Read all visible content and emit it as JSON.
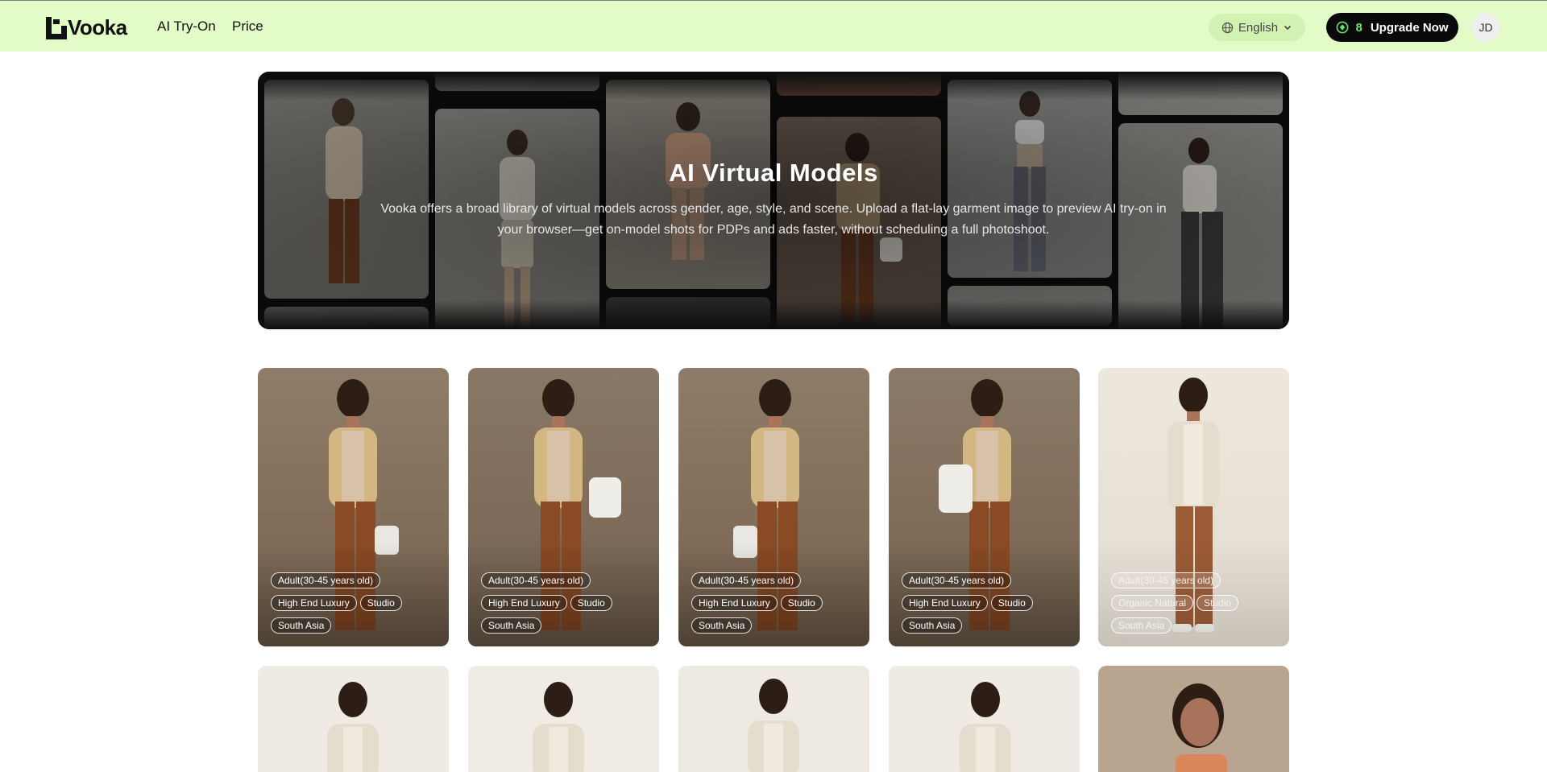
{
  "header": {
    "brand": "Vooka",
    "nav": [
      "AI Try-On",
      "Price"
    ],
    "language": "English",
    "credits": "8",
    "upgrade_label": "Upgrade Now",
    "avatar_initials": "JD"
  },
  "hero": {
    "title": "AI Virtual Models",
    "description": "Vooka offers a broad library of virtual models across gender, age, style, and scene. Upload a flat-lay garment image to preview AI try-on in your browser—get on-model shots for PDPs and ads faster, without scheduling a full photoshoot."
  },
  "gallery": {
    "cards": [
      {
        "tags": [
          "Adult(30-45 years old)",
          "High End Luxury",
          "Studio",
          "South Asia"
        ]
      },
      {
        "tags": [
          "Adult(30-45 years old)",
          "High End Luxury",
          "Studio",
          "South Asia"
        ]
      },
      {
        "tags": [
          "Adult(30-45 years old)",
          "High End Luxury",
          "Studio",
          "South Asia"
        ]
      },
      {
        "tags": [
          "Adult(30-45 years old)",
          "High End Luxury",
          "Studio",
          "South Asia"
        ]
      },
      {
        "tags": [
          "Adult(30-45 years old)",
          "Organic Natural",
          "Studio",
          "South Asia"
        ]
      }
    ]
  },
  "colors": {
    "header_bg": "#e2fbc7",
    "accent_green": "#6ee06e",
    "button_dark": "#0a0a0a"
  }
}
